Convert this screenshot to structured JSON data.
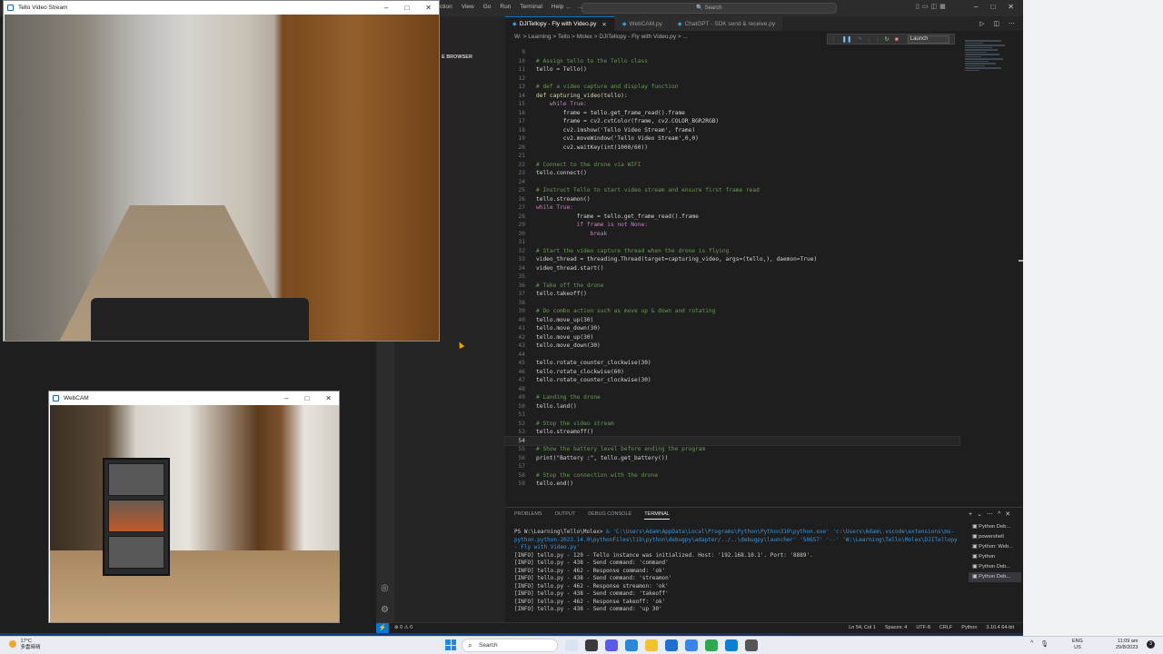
{
  "vscode": {
    "menu": [
      "ction",
      "View",
      "Go",
      "Run",
      "Terminal",
      "Help"
    ],
    "search_placeholder": "Search",
    "sidebar_title": "E BROWSER",
    "tabs": [
      {
        "label": "DJITellopy - Fly with Video.py",
        "active": true
      },
      {
        "label": "WebCAM.py",
        "active": false
      },
      {
        "label": "ChatGPT - SDK send & receive.py",
        "active": false
      }
    ],
    "breadcrumb": "W: > Learning > Tello > Molex > DJITellopy - Fly with Video.py > ...",
    "debug_config": "Launch",
    "code_lines": [
      {
        "n": "9",
        "t": ""
      },
      {
        "n": "10",
        "t": "# Assign tello to the Tello class",
        "c": "cm"
      },
      {
        "n": "11",
        "t": "tello = Tello()"
      },
      {
        "n": "12",
        "t": ""
      },
      {
        "n": "13",
        "t": "# def a video capture and display function",
        "c": "cm"
      },
      {
        "n": "14",
        "t": "def capturing_video(tello):",
        "c": "fn"
      },
      {
        "n": "15",
        "t": "    while True:",
        "c": "kw"
      },
      {
        "n": "16",
        "t": "        frame = tello.get_frame_read().frame"
      },
      {
        "n": "17",
        "t": "        frame = cv2.cvtColor(frame, cv2.COLOR_BGR2RGB)"
      },
      {
        "n": "18",
        "t": "        cv2.imshow('Tello Video Stream', frame)"
      },
      {
        "n": "19",
        "t": "        cv2.moveWindow('Tello Video Stream',0,0)"
      },
      {
        "n": "20",
        "t": "        cv2.waitKey(int(1000/60))"
      },
      {
        "n": "21",
        "t": ""
      },
      {
        "n": "22",
        "t": "# Connect to the drone via WIFI",
        "c": "cm"
      },
      {
        "n": "23",
        "t": "tello.connect()"
      },
      {
        "n": "24",
        "t": ""
      },
      {
        "n": "25",
        "t": "# Instruct Tello to start video stream and ensure first frame read",
        "c": "cm"
      },
      {
        "n": "26",
        "t": "tello.streamon()"
      },
      {
        "n": "27",
        "t": "while True:",
        "c": "kw"
      },
      {
        "n": "28",
        "t": "            frame = tello.get_frame_read().frame"
      },
      {
        "n": "29",
        "t": "            if frame is not None:",
        "c": "kw"
      },
      {
        "n": "30",
        "t": "                break",
        "c": "kw"
      },
      {
        "n": "31",
        "t": ""
      },
      {
        "n": "32",
        "t": "# Start the video capture thread when the drone is flying",
        "c": "cm"
      },
      {
        "n": "33",
        "t": "video_thread = threading.Thread(target=capturing_video, args=(tello,), daemon=True)"
      },
      {
        "n": "34",
        "t": "video_thread.start()"
      },
      {
        "n": "35",
        "t": ""
      },
      {
        "n": "36",
        "t": "# Take off the drone",
        "c": "cm"
      },
      {
        "n": "37",
        "t": "tello.takeoff()"
      },
      {
        "n": "38",
        "t": ""
      },
      {
        "n": "39",
        "t": "# Do combo action such as move up & down and rotating",
        "c": "cm"
      },
      {
        "n": "40",
        "t": "tello.move_up(30)"
      },
      {
        "n": "41",
        "t": "tello.move_down(30)"
      },
      {
        "n": "42",
        "t": "tello.move_up(30)"
      },
      {
        "n": "43",
        "t": "tello.move_down(30)"
      },
      {
        "n": "44",
        "t": ""
      },
      {
        "n": "45",
        "t": "tello.rotate_counter_clockwise(30)"
      },
      {
        "n": "46",
        "t": "tello.rotate_clockwise(60)"
      },
      {
        "n": "47",
        "t": "tello.rotate_counter_clockwise(30)"
      },
      {
        "n": "48",
        "t": ""
      },
      {
        "n": "49",
        "t": "# Landing the drone",
        "c": "cm"
      },
      {
        "n": "50",
        "t": "tello.land()"
      },
      {
        "n": "51",
        "t": ""
      },
      {
        "n": "52",
        "t": "# Stop the video stream",
        "c": "cm"
      },
      {
        "n": "53",
        "t": "tello.streamoff()"
      },
      {
        "n": "54",
        "t": "",
        "current": true
      },
      {
        "n": "55",
        "t": "# Show the battery level before ending the program",
        "c": "cm"
      },
      {
        "n": "56",
        "t": "print(\"Battery :\", tello.get_battery())"
      },
      {
        "n": "57",
        "t": ""
      },
      {
        "n": "58",
        "t": "# Stop the connection with the drone",
        "c": "cm"
      },
      {
        "n": "59",
        "t": "tello.end()"
      }
    ],
    "panel_tabs": [
      "PROBLEMS",
      "OUTPUT",
      "DEBUG CONSOLE",
      "TERMINAL"
    ],
    "terminal": {
      "prompt": "PS W:\\Learning\\Tello\\Molex>",
      "command": " & 'C:\\Users\\Adam\\AppData\\Local\\Programs\\Python\\Python310\\python.exe' 'c:\\Users\\Adam\\.vscode\\extensions\\ms-python.python-2023.14.0\\pythonFiles\\lib\\python\\debugpy\\adapter/../..\\debugpy\\launcher' '50657' '--' 'W:\\Learning\\Tello\\Molex\\DJITellopy - Fly with Video.py'",
      "output": [
        "[INFO] tello.py - 129 - Tello instance was initialized. Host: '192.168.10.1'. Port: '8889'.",
        "[INFO] tello.py - 438 - Send command: 'command'",
        "[INFO] tello.py - 462 - Response command: 'ok'",
        "[INFO] tello.py - 438 - Send command: 'streamon'",
        "[INFO] tello.py - 462 - Response streamon: 'ok'",
        "[INFO] tello.py - 438 - Send command: 'takeoff'",
        "[INFO] tello.py - 462 - Response takeoff: 'ok'",
        "[INFO] tello.py - 438 - Send command: 'up 30'"
      ]
    },
    "terminal_list": [
      {
        "label": "Python Deb...",
        "active": false
      },
      {
        "label": "powershell",
        "active": false
      },
      {
        "label": "Python: Web...",
        "active": false
      },
      {
        "label": "Python",
        "active": false
      },
      {
        "label": "Python Deb...",
        "active": false
      },
      {
        "label": "Python Deb...",
        "active": true
      }
    ],
    "status": {
      "errors": "⊗ 0 ⚠ 0",
      "position": "Ln 54, Col 1",
      "spaces": "Spaces: 4",
      "encoding": "UTF-8",
      "eol": "CRLF",
      "language": "Python",
      "interpreter": "3.10.4 64-bit"
    }
  },
  "tello_window": {
    "title": "Tello Video Stream"
  },
  "webcam_window": {
    "title": "WebCAM"
  },
  "taskbar": {
    "weather_temp": "17°C",
    "weather_desc": "多雲時晴",
    "search": "Search",
    "lang_top": "ENG",
    "lang_bottom": "US",
    "time": "11:09 am",
    "date": "29/8/2023",
    "notifications": "3"
  },
  "colors": {
    "accent": "#0078d4",
    "comment": "#6a9955",
    "keyword": "#c586c0",
    "function": "#dcdcaa"
  }
}
